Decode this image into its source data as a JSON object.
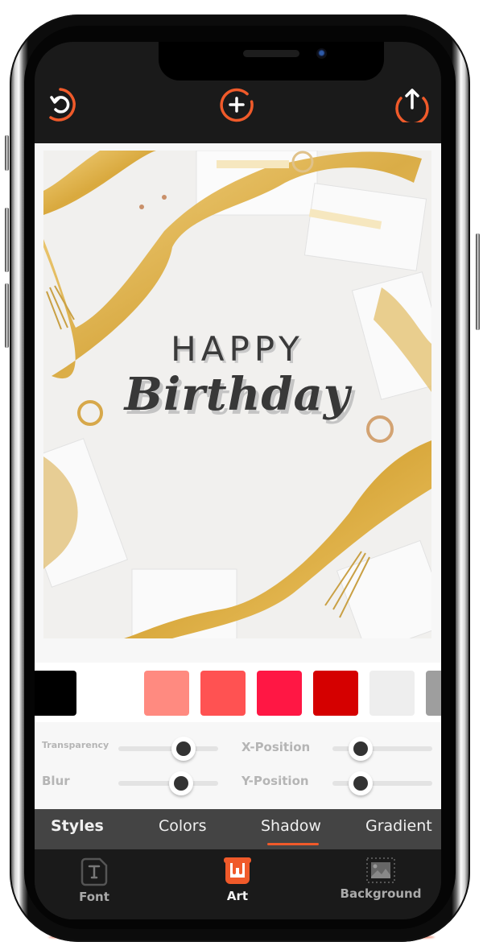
{
  "toolbar": {
    "undo_icon": "undo-circle-icon",
    "add_icon": "add-circle-icon",
    "share_icon": "share-upload-icon",
    "accent": "#f05a2a"
  },
  "canvas": {
    "line1": "HAPPY",
    "line2": "Birthday"
  },
  "swatches": [
    {
      "name": "black",
      "color": "#000000"
    },
    {
      "name": "white",
      "color": "#ffffff"
    },
    {
      "name": "salmon",
      "color": "#ff8a80"
    },
    {
      "name": "coral-red",
      "color": "#ff5252"
    },
    {
      "name": "crimson",
      "color": "#ff1744"
    },
    {
      "name": "dark-red",
      "color": "#d50000"
    },
    {
      "name": "light-gray",
      "color": "#eeeeee"
    },
    {
      "name": "gray",
      "color": "#9e9e9e"
    }
  ],
  "sliders": {
    "transparency": {
      "label": "Transparency",
      "value_percent": 65
    },
    "blur": {
      "label": "Blur",
      "value_percent": 63
    },
    "x_position": {
      "label": "X-Position",
      "value_percent": 28
    },
    "y_position": {
      "label": "Y-Position",
      "value_percent": 28
    }
  },
  "tabs": [
    {
      "label": "Styles",
      "bold": true
    },
    {
      "label": "Colors"
    },
    {
      "label": "Shadow",
      "active": true
    },
    {
      "label": "Gradient"
    }
  ],
  "bottom_nav": [
    {
      "label": "Font",
      "icon": "font-file-icon",
      "active": false
    },
    {
      "label": "Art",
      "icon": "paint-bucket-icon",
      "active": true
    },
    {
      "label": "Background",
      "icon": "image-frame-icon",
      "active": false
    }
  ]
}
